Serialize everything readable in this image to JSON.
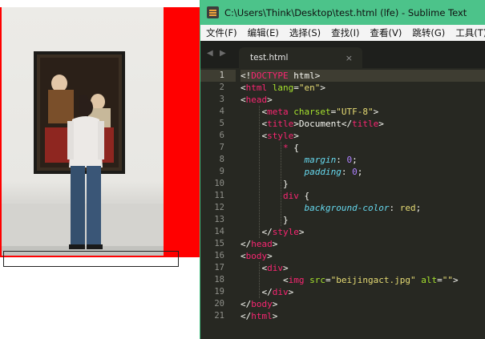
{
  "window": {
    "title": "C:\\Users\\Think\\Desktop\\test.html (lfe) - Sublime Text"
  },
  "menu": [
    "文件(F)",
    "编辑(E)",
    "选择(S)",
    "查找(I)",
    "查看(V)",
    "跳转(G)",
    "工具(T)"
  ],
  "tab": {
    "label": "test.html",
    "close": "×"
  },
  "nav": {
    "back": "◀",
    "forward": "▶"
  },
  "editor": {
    "current_line": 1,
    "lines": [
      [
        [
          "<!",
          "punct"
        ],
        [
          "DOCTYPE",
          "tag"
        ],
        [
          " html",
          "text"
        ],
        [
          ">",
          "punct"
        ]
      ],
      [
        [
          "<",
          "punct"
        ],
        [
          "html",
          "tag"
        ],
        [
          " lang",
          "attr"
        ],
        [
          "=",
          "punct"
        ],
        [
          "\"en\"",
          "str"
        ],
        [
          ">",
          "punct"
        ]
      ],
      [
        [
          "<",
          "punct"
        ],
        [
          "head",
          "tag"
        ],
        [
          ">",
          "punct"
        ]
      ],
      [
        [
          "    <",
          "punct"
        ],
        [
          "meta",
          "tag"
        ],
        [
          " charset",
          "attr"
        ],
        [
          "=",
          "punct"
        ],
        [
          "\"UTF-8\"",
          "str"
        ],
        [
          ">",
          "punct"
        ]
      ],
      [
        [
          "    <",
          "punct"
        ],
        [
          "title",
          "tag"
        ],
        [
          ">",
          "punct"
        ],
        [
          "Document",
          "text"
        ],
        [
          "</",
          "punct"
        ],
        [
          "title",
          "tag"
        ],
        [
          ">",
          "punct"
        ]
      ],
      [
        [
          "    <",
          "punct"
        ],
        [
          "style",
          "tag"
        ],
        [
          ">",
          "punct"
        ]
      ],
      [
        [
          "        ",
          "text"
        ],
        [
          "*",
          "tag"
        ],
        [
          " {",
          "punct"
        ]
      ],
      [
        [
          "            ",
          "text"
        ],
        [
          "margin",
          "prop"
        ],
        [
          ": ",
          "punct"
        ],
        [
          "0",
          "num"
        ],
        [
          ";",
          "punct"
        ]
      ],
      [
        [
          "            ",
          "text"
        ],
        [
          "padding",
          "prop"
        ],
        [
          ": ",
          "punct"
        ],
        [
          "0",
          "num"
        ],
        [
          ";",
          "punct"
        ]
      ],
      [
        [
          "        }",
          "punct"
        ]
      ],
      [
        [
          "        ",
          "text"
        ],
        [
          "div",
          "tag"
        ],
        [
          " {",
          "punct"
        ]
      ],
      [
        [
          "            ",
          "text"
        ],
        [
          "background-color",
          "prop"
        ],
        [
          ": ",
          "punct"
        ],
        [
          "red",
          "str"
        ],
        [
          ";",
          "punct"
        ]
      ],
      [
        [
          "        }",
          "punct"
        ]
      ],
      [
        [
          "    </",
          "punct"
        ],
        [
          "style",
          "tag"
        ],
        [
          ">",
          "punct"
        ]
      ],
      [
        [
          "</",
          "punct"
        ],
        [
          "head",
          "tag"
        ],
        [
          ">",
          "punct"
        ]
      ],
      [
        [
          "<",
          "punct"
        ],
        [
          "body",
          "tag"
        ],
        [
          ">",
          "punct"
        ]
      ],
      [
        [
          "    <",
          "punct"
        ],
        [
          "div",
          "tag"
        ],
        [
          ">",
          "punct"
        ]
      ],
      [
        [
          "        <",
          "punct"
        ],
        [
          "img",
          "tag"
        ],
        [
          " src",
          "attr"
        ],
        [
          "=",
          "punct"
        ],
        [
          "\"beijingact.jpg\"",
          "str"
        ],
        [
          " alt",
          "attr"
        ],
        [
          "=",
          "punct"
        ],
        [
          "\"\"",
          "str"
        ],
        [
          ">",
          "punct"
        ]
      ],
      [
        [
          "    </",
          "punct"
        ],
        [
          "div",
          "tag"
        ],
        [
          ">",
          "punct"
        ]
      ],
      [
        [
          "</",
          "punct"
        ],
        [
          "body",
          "tag"
        ],
        [
          ">",
          "punct"
        ]
      ],
      [
        [
          "</",
          "punct"
        ],
        [
          "html",
          "tag"
        ],
        [
          ">",
          "punct"
        ]
      ]
    ]
  },
  "colors": {
    "titlebar": "#4cc38a",
    "editor_bg": "#272822",
    "div_background": "#ff0000",
    "tag": "#f92672",
    "attr": "#a6e22e",
    "string": "#e6db74",
    "property": "#66d9ef",
    "number": "#ae81ff"
  }
}
